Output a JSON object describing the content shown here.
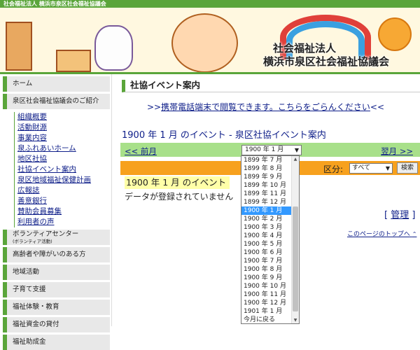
{
  "header": {
    "topbar_text": "社会福祉法人 横浜市泉区社会福祉協議会",
    "title_line1": "社会福祉法人",
    "title_line2": "横浜市泉区社会福祉協議会"
  },
  "sidebar": {
    "home": "ホーム",
    "intro": "泉区社会福祉協議会のご紹介",
    "sub_items": [
      "組織概要",
      "活動財源",
      "事業内容",
      "泉ふれあいホーム",
      "地区社協",
      "社協イベント案内",
      "泉区地域福祉保健計画",
      "広報誌",
      "善意銀行",
      "賛助会員募集",
      "利用者の声"
    ],
    "volunteer_center": "ボランティアセンター",
    "volunteer_sub": "(ボランティア活動)",
    "sections": [
      "高齢者や障がいのある方",
      "地域活動",
      "子育て支援",
      "福祉体験・教育",
      "福祉資金の貸付",
      "福祉助成金"
    ]
  },
  "main": {
    "section_title": "社協イベント案内",
    "mobile_link_prefix": ">>",
    "mobile_link": "携帯電話端末で閲覧できます。こちらをごらんください",
    "mobile_link_suffix": "<<",
    "headline": "1900 年 1 月 のイベント - 泉区社協イベント案内",
    "prev_label": "<< 前月",
    "next_label": "翌月 >>",
    "month_select_value": "1900 年 1 月",
    "filter_label": "区分:",
    "category_select_value": "すべて",
    "search_button": "検索",
    "event_label": "1900 年 1 月 のイベント",
    "no_data": "データが登録されていません",
    "admin_link": "管理",
    "admin_open": "[",
    "admin_close": "]",
    "to_top": "このページのトップへ",
    "to_top_arrow": "⌃"
  },
  "dropdown": {
    "options": [
      "1899 年 7 月",
      "1899 年 8 月",
      "1899 年 9 月",
      "1899 年 10 月",
      "1899 年 11 月",
      "1899 年 12 月",
      "1900 年 1 月",
      "1900 年 2 月",
      "1900 年 3 月",
      "1900 年 4 月",
      "1900 年 5 月",
      "1900 年 6 月",
      "1900 年 7 月",
      "1900 年 8 月",
      "1900 年 9 月",
      "1900 年 10 月",
      "1900 年 11 月",
      "1900 年 12 月",
      "1901 年 1 月",
      "今月に戻る"
    ],
    "selected": "1900 年 1 月"
  },
  "colors": {
    "accent_green": "#5aa53a",
    "nav_green": "#a8e08a",
    "filter_orange": "#f7a11e",
    "link_blue": "#10208a",
    "highlight_yellow": "#ffffa8",
    "selection_blue": "#3399ff"
  }
}
